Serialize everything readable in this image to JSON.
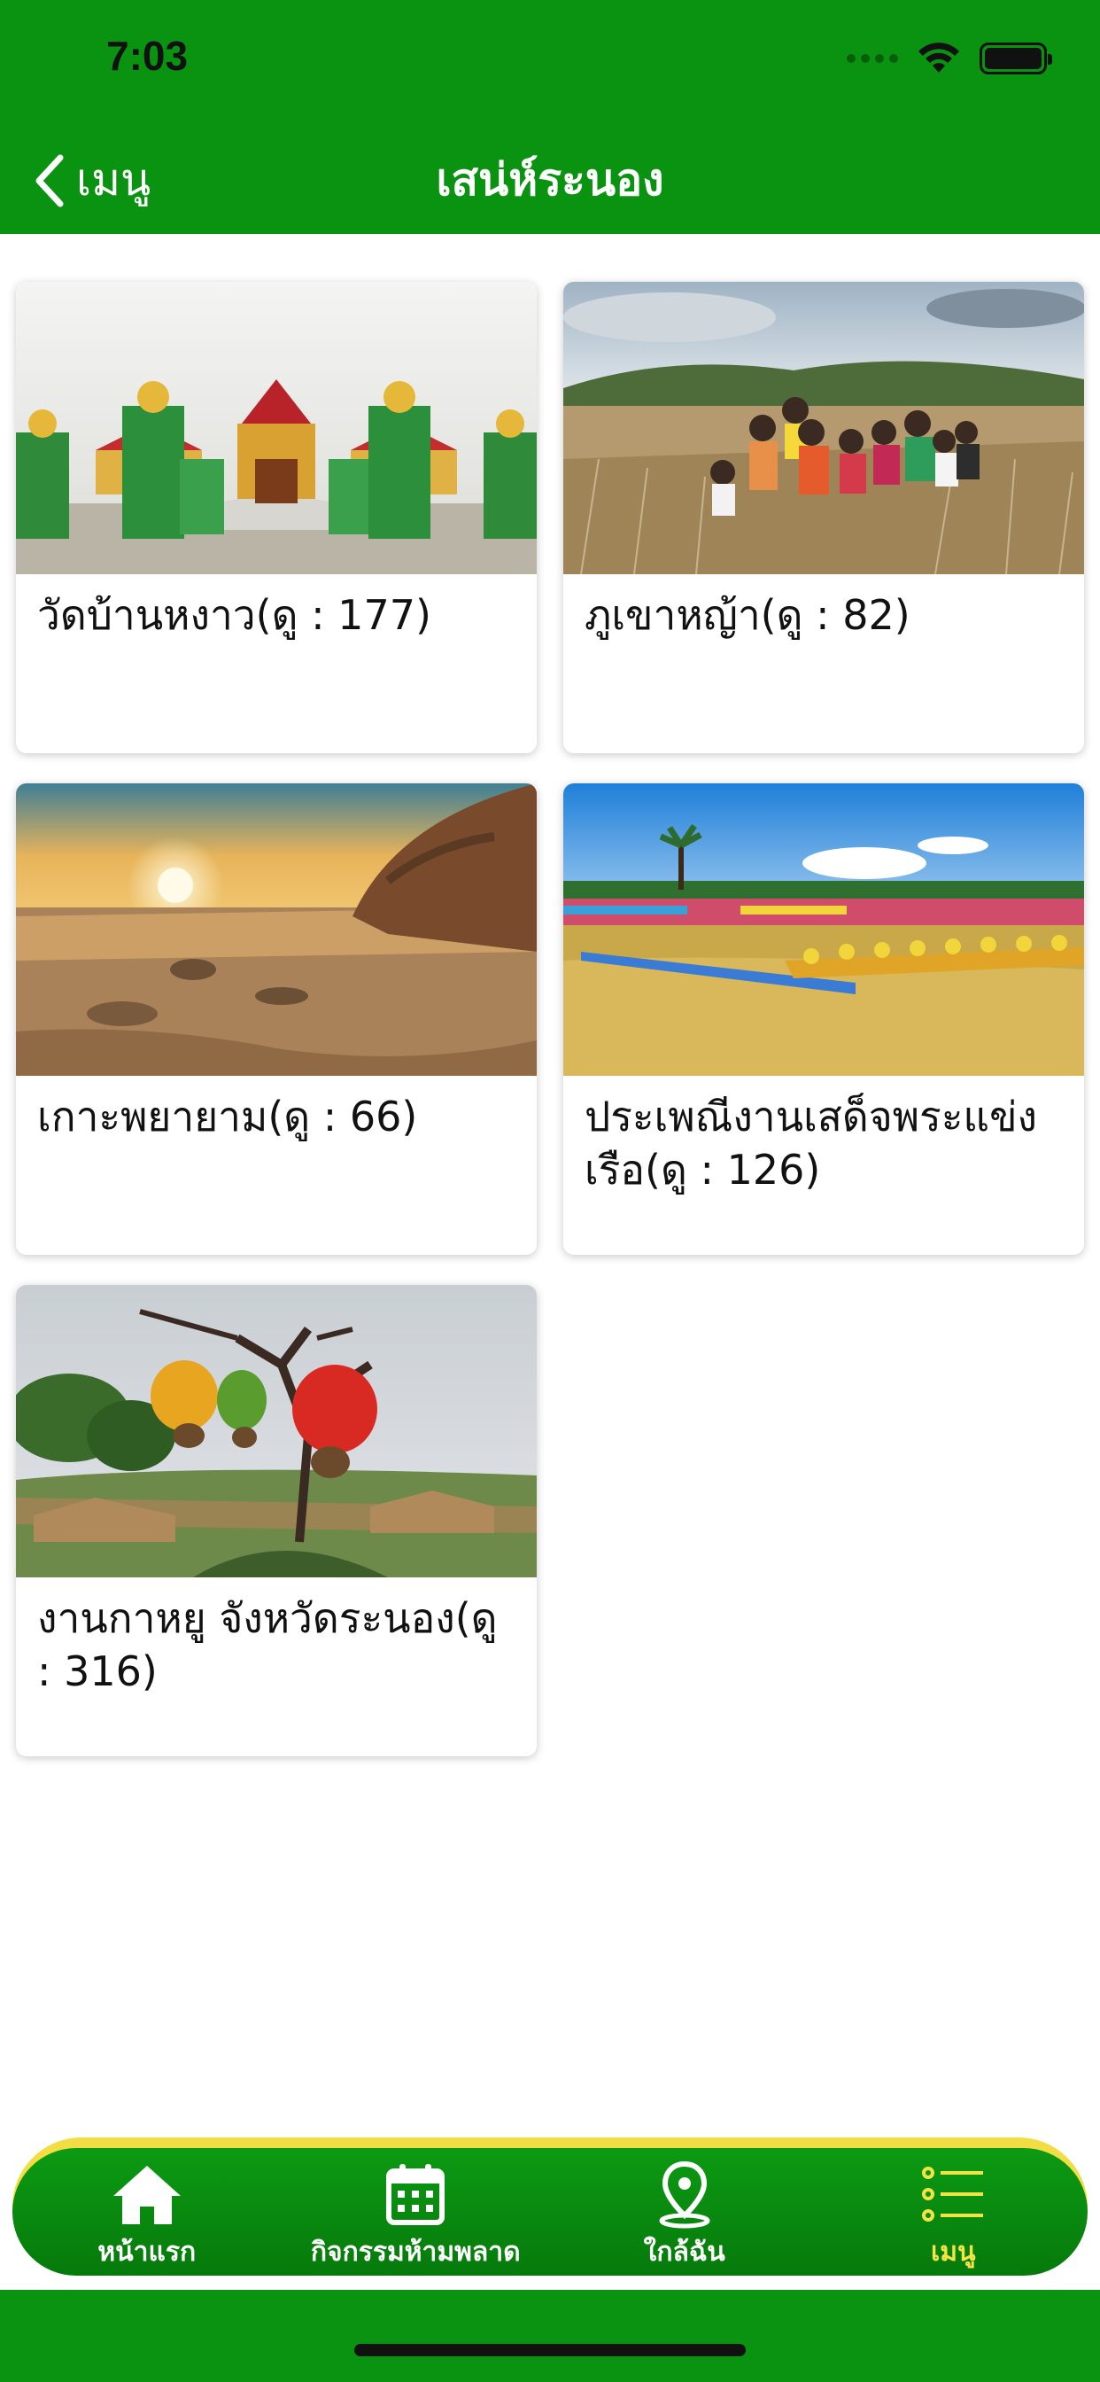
{
  "status_bar": {
    "time": "7:03"
  },
  "nav": {
    "back_label": "เมนู",
    "title": "เสน่ห์ระนอง"
  },
  "cards": [
    {
      "title": "วัดบ้านหงาว(ดู : 177)",
      "image": "temple-naga-photo"
    },
    {
      "title": "ภูเขาหญ้า(ดู : 82)",
      "image": "grass-hill-group-photo"
    },
    {
      "title": "เกาะพยายาม(ดู : 66)",
      "image": "sunset-beach-photo"
    },
    {
      "title": "ประเพณีงานเสด็จพระแข่งเรือ(ดู : 126)",
      "image": "boat-race-photo"
    },
    {
      "title": "งานกาหยู จังหวัดระนอง(ดู : 316)",
      "image": "cashew-sculpture-photo"
    }
  ],
  "tabbar": {
    "items": [
      {
        "label": "หน้าแรก",
        "icon": "home-icon"
      },
      {
        "label": "กิจกรรมห้ามพลาด",
        "icon": "calendar-icon"
      },
      {
        "label": "ใกล้ฉัน",
        "icon": "location-pin-icon"
      },
      {
        "label": "เมนู",
        "icon": "menu-list-icon",
        "active": true
      }
    ]
  },
  "colors": {
    "primary_green": "#099310",
    "accent_yellow": "#f4e442"
  }
}
